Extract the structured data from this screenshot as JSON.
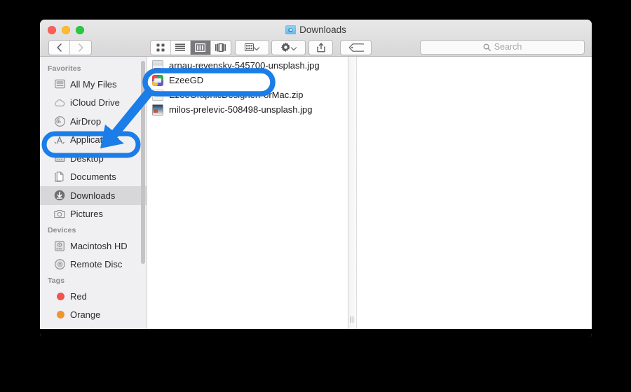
{
  "window": {
    "title": "Downloads",
    "title_icon": "downloads-folder-icon",
    "controls": {
      "close": "close-button",
      "minimize": "minimize-button",
      "zoom": "zoom-button"
    }
  },
  "toolbar": {
    "back_label": "‹",
    "forward_label": "›",
    "view_buttons": [
      {
        "name": "icon-view",
        "label": "icon-view-icon",
        "selected": false
      },
      {
        "name": "list-view",
        "label": "list-view-icon",
        "selected": false
      },
      {
        "name": "column-view",
        "label": "column-view-icon",
        "selected": true
      },
      {
        "name": "coverflow-view",
        "label": "coverflow-view-icon",
        "selected": false
      }
    ],
    "arrange_label": "arrange-icon",
    "action_label": "gear-icon",
    "share_label": "share-icon",
    "tag_label": "tag-icon"
  },
  "search": {
    "placeholder": "Search",
    "value": ""
  },
  "sidebar": {
    "sections": [
      {
        "header": "Favorites",
        "items": [
          {
            "label": "All My Files",
            "icon": "all-my-files-icon",
            "selected": false
          },
          {
            "label": "iCloud Drive",
            "icon": "icloud-drive-icon",
            "selected": false
          },
          {
            "label": "AirDrop",
            "icon": "airdrop-icon",
            "selected": false
          },
          {
            "label": "Applications",
            "icon": "applications-icon",
            "selected": false
          },
          {
            "label": "Desktop",
            "icon": "desktop-icon",
            "selected": false
          },
          {
            "label": "Documents",
            "icon": "documents-icon",
            "selected": false
          },
          {
            "label": "Downloads",
            "icon": "downloads-icon",
            "selected": true
          },
          {
            "label": "Pictures",
            "icon": "pictures-icon",
            "selected": false
          }
        ]
      },
      {
        "header": "Devices",
        "items": [
          {
            "label": "Macintosh HD",
            "icon": "hard-disk-icon",
            "selected": false
          },
          {
            "label": "Remote Disc",
            "icon": "optical-disc-icon",
            "selected": false
          }
        ]
      },
      {
        "header": "Tags",
        "items": [
          {
            "label": "Red",
            "icon": "tag-dot-icon",
            "color": "#f4524d",
            "selected": false
          },
          {
            "label": "Orange",
            "icon": "tag-dot-icon",
            "color": "#f0942e",
            "selected": false
          }
        ]
      }
    ]
  },
  "file_list": [
    {
      "name": "arnau-revensky-545700-unsplash.jpg",
      "icon": "jpg-photo-icon",
      "kind": "photo"
    },
    {
      "name": "EzeeGD",
      "icon": "ezeegd-app-icon",
      "kind": "application"
    },
    {
      "name": "EzeeGraphicDesignerForMac.zip",
      "icon": "zip-archive-icon",
      "kind": "archive"
    },
    {
      "name": "milos-prelevic-508498-unsplash.jpg",
      "icon": "jpg-photo-icon",
      "kind": "photo"
    }
  ],
  "annotations": {
    "color": "#1a7de8",
    "highlight_file": "EzeeGD",
    "highlight_sidebar_item": "Applications",
    "arrow_meaning": "drag EzeeGD to Applications"
  }
}
